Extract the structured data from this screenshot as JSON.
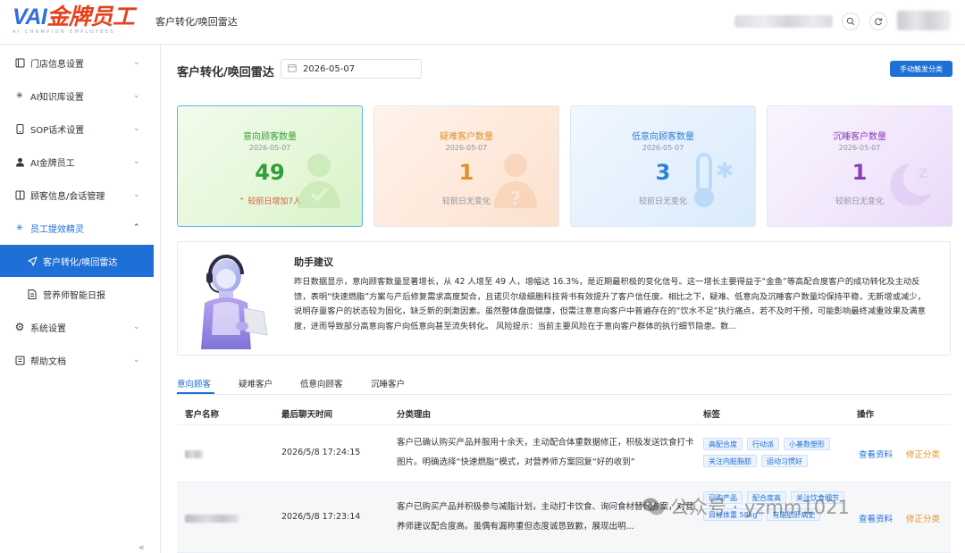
{
  "header": {
    "logo_main": "VAI金牌员工",
    "logo_sub": "AI CHAMPION EMPLOYEES",
    "title": "客户转化/唤回雷达"
  },
  "sidebar": {
    "items": [
      {
        "label": "门店信息设置",
        "icon": "store-icon"
      },
      {
        "label": "AI知识库设置",
        "icon": "sparkle-icon"
      },
      {
        "label": "SOP话术设置",
        "icon": "phone-icon"
      },
      {
        "label": "AI金牌员工",
        "icon": "person-icon"
      },
      {
        "label": "顾客信息/会话管理",
        "icon": "book-icon"
      },
      {
        "label": "员工提效精灵",
        "icon": "sparkle-icon"
      },
      {
        "label": "客户转化/唤回雷达",
        "icon": "send-icon"
      },
      {
        "label": "营养师智能日报",
        "icon": "document-icon"
      },
      {
        "label": "系统设置",
        "icon": "gear-icon"
      },
      {
        "label": "帮助文档",
        "icon": "book-icon"
      }
    ]
  },
  "page": {
    "title": "客户转化/唤回雷达",
    "date": "2026-05-07",
    "trigger_button": "手动触发分类"
  },
  "cards": [
    {
      "title": "意向顾客数量",
      "date": "2026-05-07",
      "value": "49",
      "note": "较前日增加7人",
      "arrow": "⌃",
      "color": "#3aa13a",
      "accent": "#2f9e38"
    },
    {
      "title": "疑难客户数量",
      "date": "2026-05-07",
      "value": "1",
      "note": "较前日无变化",
      "color": "#e0902e"
    },
    {
      "title": "低意向顾客数量",
      "date": "2026-05-07",
      "value": "3",
      "note": "较前日无变化",
      "color": "#2f7fd3"
    },
    {
      "title": "沉睡客户数量",
      "date": "2026-05-07",
      "value": "1",
      "note": "较前日无变化",
      "color": "#8a3fb8"
    }
  ],
  "advice": {
    "title": "助手建议",
    "body": "昨日数据显示，意向顾客数量显著增长，从 42 人增至 49 人，增幅达 16.3%，是近期最积极的变化信号。这一增长主要得益于“金鱼”等高配合度客户的成功转化及主动反馈，表明“快速燃脂”方案与产后修复需求高度契合，且诺贝尔级细胞科技背书有效提升了客户信任度。相比之下，疑难、低意向及沉睡客户数量均保持平稳，无新增或减少，说明存量客户的状态较为固化，缺乏新的刺激因素。虽然整体盘面健康，但需注意意向客户中普遍存在的“饮水不足”执行痛点，若不及时干预，可能影响最终减重效果及满意度，进而导致部分高意向客户向低意向甚至流失转化。 风险提示：当前主要风险在于意向客户群体的执行细节隐患。数..."
  },
  "tabs": [
    "意向顾客",
    "疑难客户",
    "低意向顾客",
    "沉睡客户"
  ],
  "table": {
    "columns": [
      "客户名称",
      "最后聊天时间",
      "分类理由",
      "标签",
      "操作"
    ],
    "rows": [
      {
        "time": "2026/5/8 17:24:15",
        "reason": "客户已确认购买产品并服用十余天，主动配合体重数据修正，积极发送饮食打卡图片。明确选择“快速燃脂”模式，对营养师方案回复“好的收到”",
        "tags": [
          "高配合度",
          "行动派",
          "小基数塑形",
          "关注内脏脂肪",
          "运动习惯好"
        ],
        "ops": [
          "查看资料",
          "修正分类"
        ]
      },
      {
        "time": "2026/5/8 17:23:14",
        "reason": "客户已购买产品并积极参与减脂计划，主动打卡饮食、询问食材替代方案，对营养师建议配合度高。虽偶有漏称重但态度诚恳致歉，展现出明...",
        "tags": [
          "已购产品",
          "配合度高",
          "关注饮食细节",
          "目标体重 58kg",
          "有脂肪肝病史"
        ],
        "ops": [
          "查看资料",
          "修正分类"
        ]
      }
    ]
  },
  "watermark": "公众号 · yzmm1021"
}
